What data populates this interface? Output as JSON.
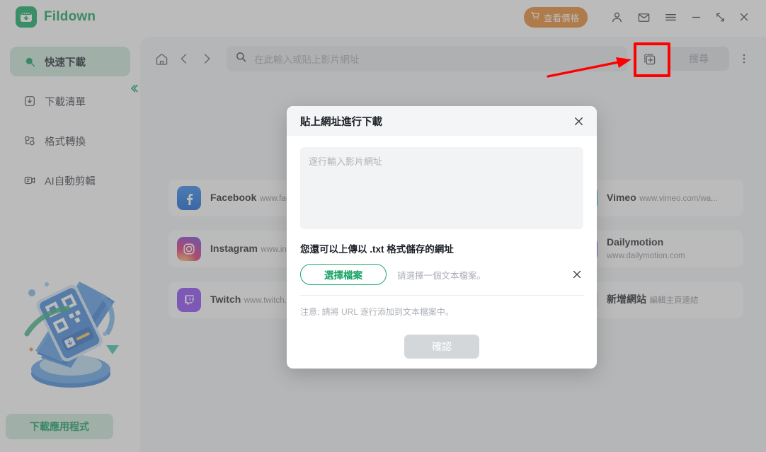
{
  "window": {
    "brand": "Fildown",
    "price_button": "查看價格",
    "icons": {
      "cart": "cart-icon",
      "account": "account-icon",
      "mail": "mail-icon",
      "menu": "hamburger-menu-icon",
      "minimize": "minimize-icon",
      "restore": "restore-icon",
      "close": "close-icon"
    }
  },
  "sidebar": {
    "items": [
      {
        "label": "快速下載",
        "icon": "magnifier-download-icon",
        "active": true
      },
      {
        "label": "下載清單",
        "icon": "download-list-icon",
        "active": false
      },
      {
        "label": "格式轉換",
        "icon": "convert-icon",
        "active": false
      },
      {
        "label": "AI自動剪輯",
        "icon": "ai-clip-icon",
        "active": false
      }
    ],
    "collapse_icon": "chevron-left-icon",
    "download_app_button": "下載應用程式",
    "illustration": "qr-phone-illustration"
  },
  "toolbar": {
    "home_icon": "home-icon",
    "back_icon": "chevron-left-icon",
    "forward_icon": "chevron-right-icon",
    "search_icon": "search-icon",
    "search_placeholder": "在此輸入或貼上影片網址",
    "add_multi_icon": "add-multiple-urls-icon",
    "search_button": "搜尋",
    "more_icon": "kebab-menu-icon"
  },
  "sites": [
    {
      "name": "Facebook",
      "url": "www.facebook.com",
      "icon": "facebook-icon",
      "color": "#1877f2"
    },
    {
      "name": "",
      "url": "",
      "icon": "hidden-icon",
      "color": "#ffffff"
    },
    {
      "name": "Vimeo",
      "url": "www.vimeo.com/wa...",
      "icon": "vimeo-icon",
      "color": "#1ab7ea"
    },
    {
      "name": "Instagram",
      "url": "www.instagram.com",
      "icon": "instagram-icon",
      "color": "#d62976"
    },
    {
      "name": "",
      "url": "",
      "icon": "hidden-icon",
      "color": "#ffffff"
    },
    {
      "name": "Dailymotion",
      "url": "www.dailymotion.com",
      "icon": "dailymotion-icon",
      "color": "#5b3bd4"
    },
    {
      "name": "Twitch",
      "url": "www.twitch.tv",
      "icon": "twitch-icon",
      "color": "#8b44f7"
    },
    {
      "name": "",
      "url": "",
      "icon": "hidden-icon",
      "color": "#ffffff"
    },
    {
      "name": "新增網站",
      "url": "編輯主頁連結",
      "icon": "plus-icon",
      "color": "#dcdfe3"
    }
  ],
  "modal": {
    "title": "貼上網址進行下載",
    "close_icon": "close-icon",
    "url_placeholder": "逐行輸入影片網址",
    "upload_title": "您還可以上傳以 .txt 格式儲存的網址",
    "choose_file_button": "選擇檔案",
    "file_hint": "請選擇一個文本檔案。",
    "clear_icon": "close-icon",
    "note": "注意: 請將 URL 逐行添加到文本檔案中。",
    "confirm_button": "確認"
  },
  "annotations": {
    "highlight_color": "#ff0000",
    "box_target": "add-multiple-urls-icon",
    "arrow": "red-arrow-pointing-right"
  },
  "colors": {
    "brand_green": "#12a05f",
    "accent_green": "#1aa86a",
    "sidebar_active": "#cfe9dd",
    "price_orange": "#e8872a",
    "panel_bg": "#f3f5f7"
  }
}
